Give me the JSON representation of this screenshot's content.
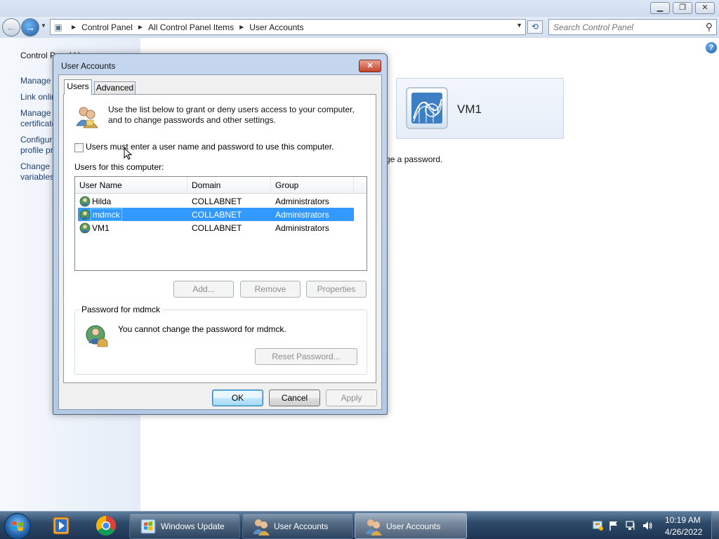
{
  "explorer": {
    "breadcrumbs": [
      "Control Panel",
      "All Control Panel Items",
      "User Accounts"
    ],
    "search_placeholder": "Search Control Panel",
    "left_pane": {
      "home_link": "Control Panel Home",
      "links": [
        "Manage your credentials",
        "Link online IDs",
        "Manage your file encryption",
        "certificates",
        "Configure advanced user",
        "profile properties",
        "Change my environment",
        "variables"
      ]
    },
    "user_tile": {
      "name": "VM1"
    },
    "partial_text": "ge a password."
  },
  "dialog": {
    "title": "User Accounts",
    "close_label": "✕",
    "tabs": [
      {
        "label": "Users",
        "selected": true
      },
      {
        "label": "Advanced",
        "selected": false
      }
    ],
    "intro_text": "Use the list below to grant or deny users access to your computer, and to change passwords and other settings.",
    "require_login_label": "Users must enter a user name and password to use this computer.",
    "require_login_checked": false,
    "users_for_label": "Users for this computer:",
    "columns": [
      "User Name",
      "Domain",
      "Group"
    ],
    "users": [
      {
        "name": "Hilda",
        "domain": "COLLABNET",
        "group": "Administrators",
        "selected": false
      },
      {
        "name": "mdmck",
        "domain": "COLLABNET",
        "group": "Administrators",
        "selected": true
      },
      {
        "name": "VM1",
        "domain": "COLLABNET",
        "group": "Administrators",
        "selected": false
      }
    ],
    "buttons": {
      "add": "Add...",
      "remove": "Remove",
      "properties": "Properties",
      "reset_password": "Reset Password...",
      "ok": "OK",
      "cancel": "Cancel",
      "apply": "Apply"
    },
    "password_group_label": "Password for mdmck",
    "password_message": "You cannot change the password for mdmck."
  },
  "taskbar": {
    "tasks": [
      {
        "label": "Windows Update",
        "active": false
      },
      {
        "label": "User Accounts",
        "active": false
      },
      {
        "label": "User Accounts",
        "active": true
      }
    ],
    "clock_time": "10:19 AM",
    "clock_date": "4/26/2022"
  },
  "colors": {
    "selection": "#3399ff",
    "link": "#1e3e74",
    "taskbar": "#2e4a69"
  }
}
